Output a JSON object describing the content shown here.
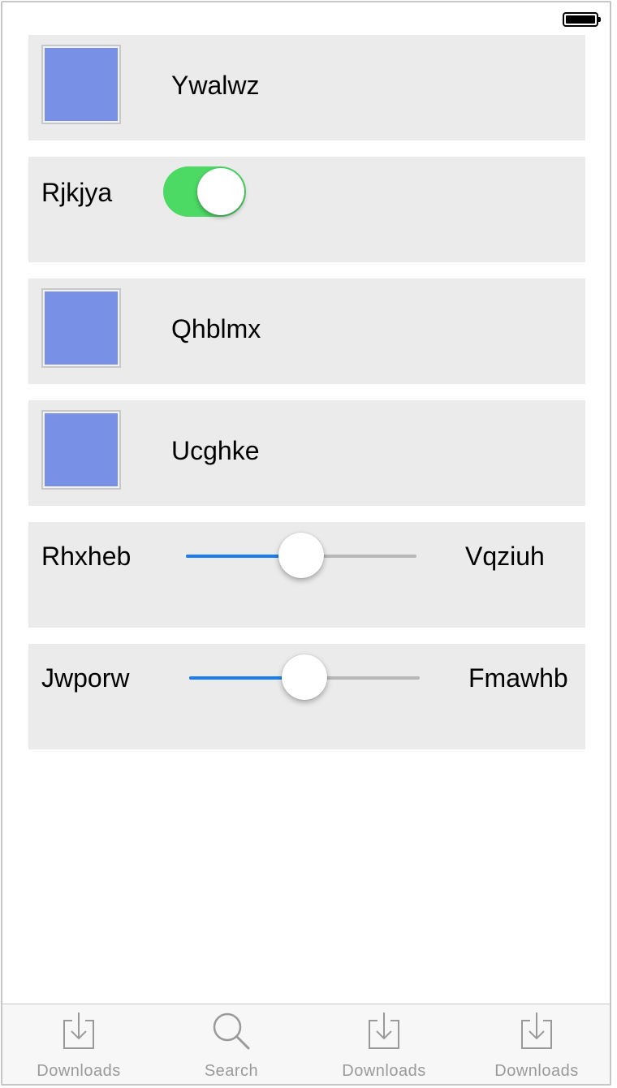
{
  "status_bar": {
    "battery_level": 1.0
  },
  "rows": [
    {
      "type": "image",
      "label": "Ywalwz",
      "image_color": "#7890e6"
    },
    {
      "type": "toggle",
      "label": "Rjkjya",
      "on": true,
      "on_color": "#4cd964"
    },
    {
      "type": "image",
      "label": "Qhblmx",
      "image_color": "#7890e6"
    },
    {
      "type": "image",
      "label": "Ucghke",
      "image_color": "#7890e6"
    },
    {
      "type": "slider",
      "min_label": "Rhxheb",
      "max_label": "Vqziuh",
      "value": 0.5
    },
    {
      "type": "slider",
      "min_label": "Jwporw",
      "max_label": "Fmawhb",
      "value": 0.5
    }
  ],
  "colors": {
    "row_background": "#ebebeb",
    "slider_min_track": "#1a7ef1",
    "slider_max_track": "#b7b7b7",
    "tab_inactive": "#9a9a9a"
  },
  "tabbar": {
    "items": [
      {
        "label": "Downloads",
        "icon": "download-icon"
      },
      {
        "label": "Search",
        "icon": "search-icon"
      },
      {
        "label": "Downloads",
        "icon": "download-icon"
      },
      {
        "label": "Downloads",
        "icon": "download-icon"
      }
    ]
  }
}
